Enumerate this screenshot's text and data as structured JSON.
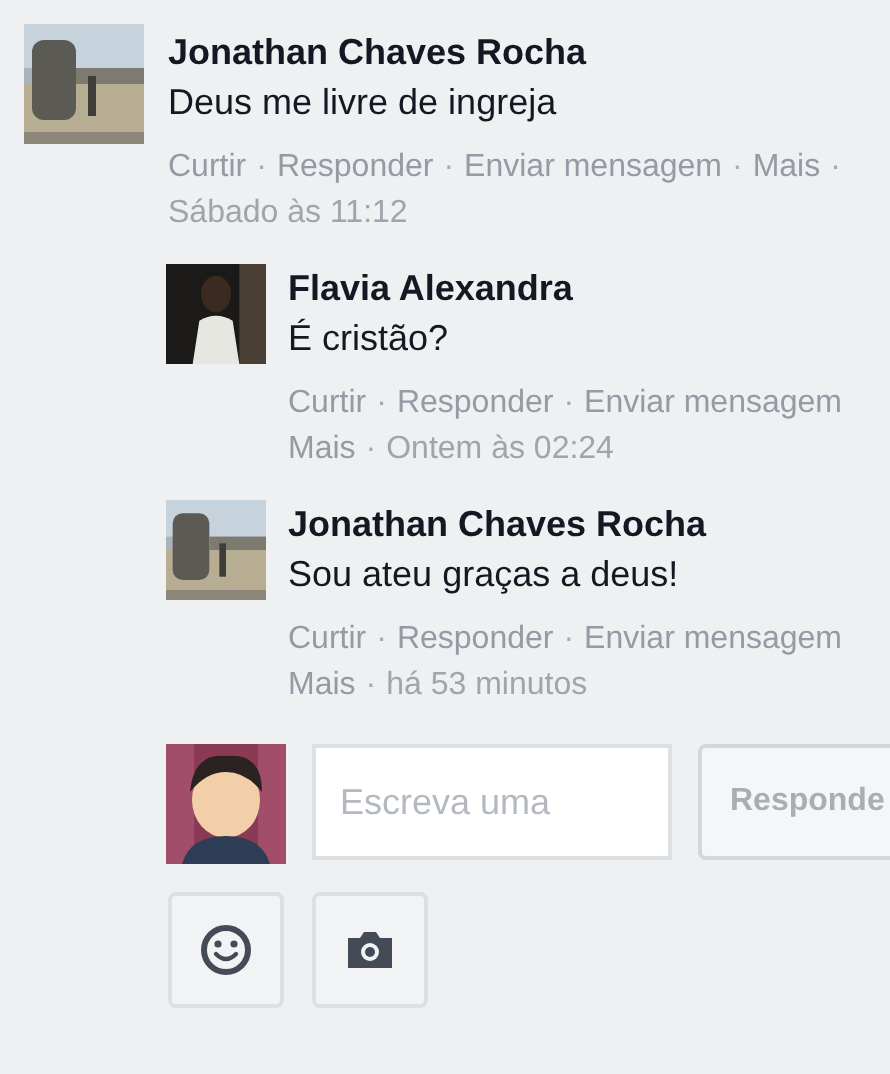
{
  "comments": [
    {
      "author": "Jonathan Chaves Rocha",
      "text": "Deus me livre de ingreja",
      "meta_lines": [
        [
          {
            "kind": "link",
            "text": "Curtir"
          },
          {
            "kind": "sep",
            "text": "·"
          },
          {
            "kind": "link",
            "text": "Responder"
          },
          {
            "kind": "sep",
            "text": "·"
          },
          {
            "kind": "link",
            "text": "Enviar mensagem"
          },
          {
            "kind": "sep",
            "text": "·"
          },
          {
            "kind": "link",
            "text": "Mais"
          },
          {
            "kind": "sep",
            "text": "·"
          }
        ],
        [
          {
            "kind": "time",
            "text": "Sábado às 11:12"
          }
        ]
      ],
      "replies": [
        {
          "author": "Flavia Alexandra",
          "text": "É cristão?",
          "meta_lines": [
            [
              {
                "kind": "link",
                "text": "Curtir"
              },
              {
                "kind": "sep",
                "text": "·"
              },
              {
                "kind": "link",
                "text": "Responder"
              },
              {
                "kind": "sep",
                "text": "·"
              },
              {
                "kind": "link",
                "text": "Enviar mensagem"
              }
            ],
            [
              {
                "kind": "link",
                "text": "Mais"
              },
              {
                "kind": "sep",
                "text": "·"
              },
              {
                "kind": "time",
                "text": "Ontem às 02:24"
              }
            ]
          ]
        },
        {
          "author": "Jonathan Chaves Rocha",
          "text": "Sou ateu graças a deus!",
          "meta_lines": [
            [
              {
                "kind": "link",
                "text": "Curtir"
              },
              {
                "kind": "sep",
                "text": "·"
              },
              {
                "kind": "link",
                "text": "Responder"
              },
              {
                "kind": "sep",
                "text": "·"
              },
              {
                "kind": "link",
                "text": "Enviar mensagem"
              }
            ],
            [
              {
                "kind": "link",
                "text": "Mais"
              },
              {
                "kind": "sep",
                "text": "·"
              },
              {
                "kind": "time",
                "text": "há 53 minutos"
              }
            ]
          ]
        }
      ]
    }
  ],
  "composer": {
    "placeholder": "Escreva uma",
    "reply_button": "Responde"
  }
}
